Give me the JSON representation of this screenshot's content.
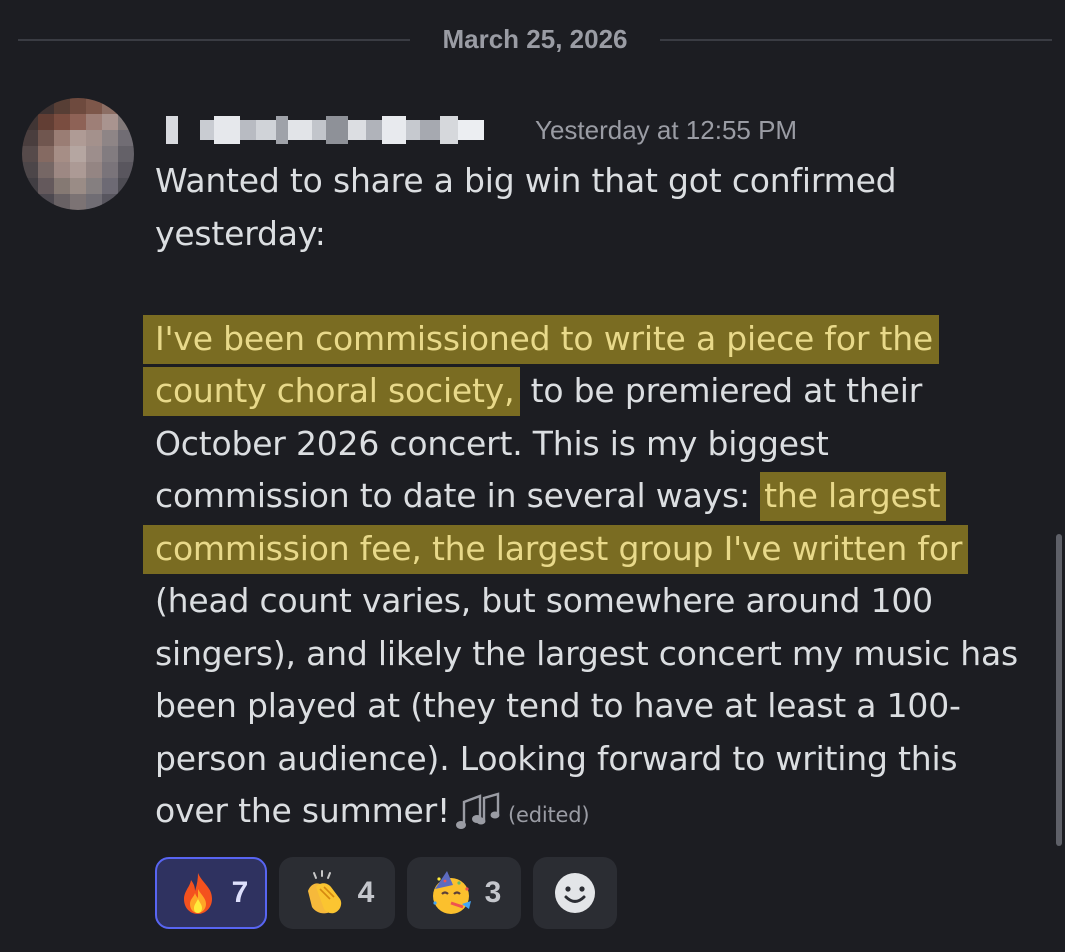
{
  "divider": {
    "date": "March 25, 2026"
  },
  "message": {
    "author_redacted": true,
    "timestamp": "Yesterday at 12:55 PM",
    "lines": {
      "l1": "Wanted to share a big win that got confirmed",
      "l2": "yesterday:",
      "l4_hl": "I've been commissioned to write a piece for the",
      "l5_hl": "county choral society,",
      "l5_rest": " to be premiered at their",
      "l6": "October 2026 concert. This is my biggest",
      "l7_pre": "commission to date in several ways: ",
      "l7_hl": "the largest",
      "l8_hl": "commission fee, the largest group I've written for",
      "l9": "(head count varies, but somewhere around 100",
      "l10": "singers), and likely the largest concert my music has",
      "l11": "been played at (they tend to have at least a 100-",
      "l12": "person audience). Looking forward to writing this",
      "l13": "over the summer!"
    },
    "trailing_emoji": "notes-icon",
    "edited_label": "(edited)",
    "highlight_color": "#7a6c22"
  },
  "reactions": [
    {
      "emoji": "fire-icon",
      "count": "7",
      "active": true
    },
    {
      "emoji": "clapping-hands-icon",
      "count": "4",
      "active": false
    },
    {
      "emoji": "partying-face-icon",
      "count": "3",
      "active": false
    },
    {
      "emoji": "add-reaction-icon",
      "count": "",
      "active": false
    }
  ],
  "colors": {
    "background": "#1c1d22",
    "text": "#dbdee1",
    "muted": "#9a9ca4",
    "accent": "#5865f2"
  }
}
